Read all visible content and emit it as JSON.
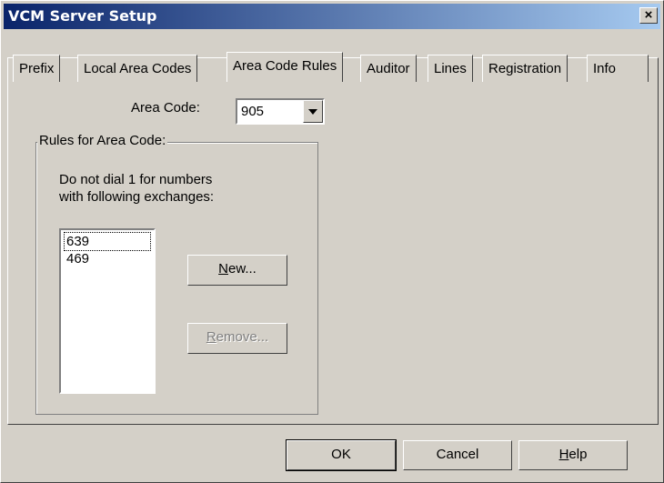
{
  "window": {
    "title": "VCM Server Setup",
    "close_label": "×"
  },
  "tabs": [
    "Prefix",
    "Local Area Codes",
    "Area Code Rules",
    "Auditor",
    "Lines",
    "Registration",
    "Info"
  ],
  "area_code": {
    "label": "Area Code:",
    "value": "905"
  },
  "rules_group": {
    "label": "Rules for Area Code:",
    "description_line1": "Do not dial 1 for numbers",
    "description_line2": "with following exchanges:",
    "exchanges": [
      "639",
      "469"
    ]
  },
  "buttons": {
    "new_mn": "N",
    "new_rest": "ew...",
    "remove_mn": "R",
    "remove_rest": "emove...",
    "ok": "OK",
    "cancel": "Cancel",
    "help_mn": "H",
    "help_rest": "elp"
  }
}
